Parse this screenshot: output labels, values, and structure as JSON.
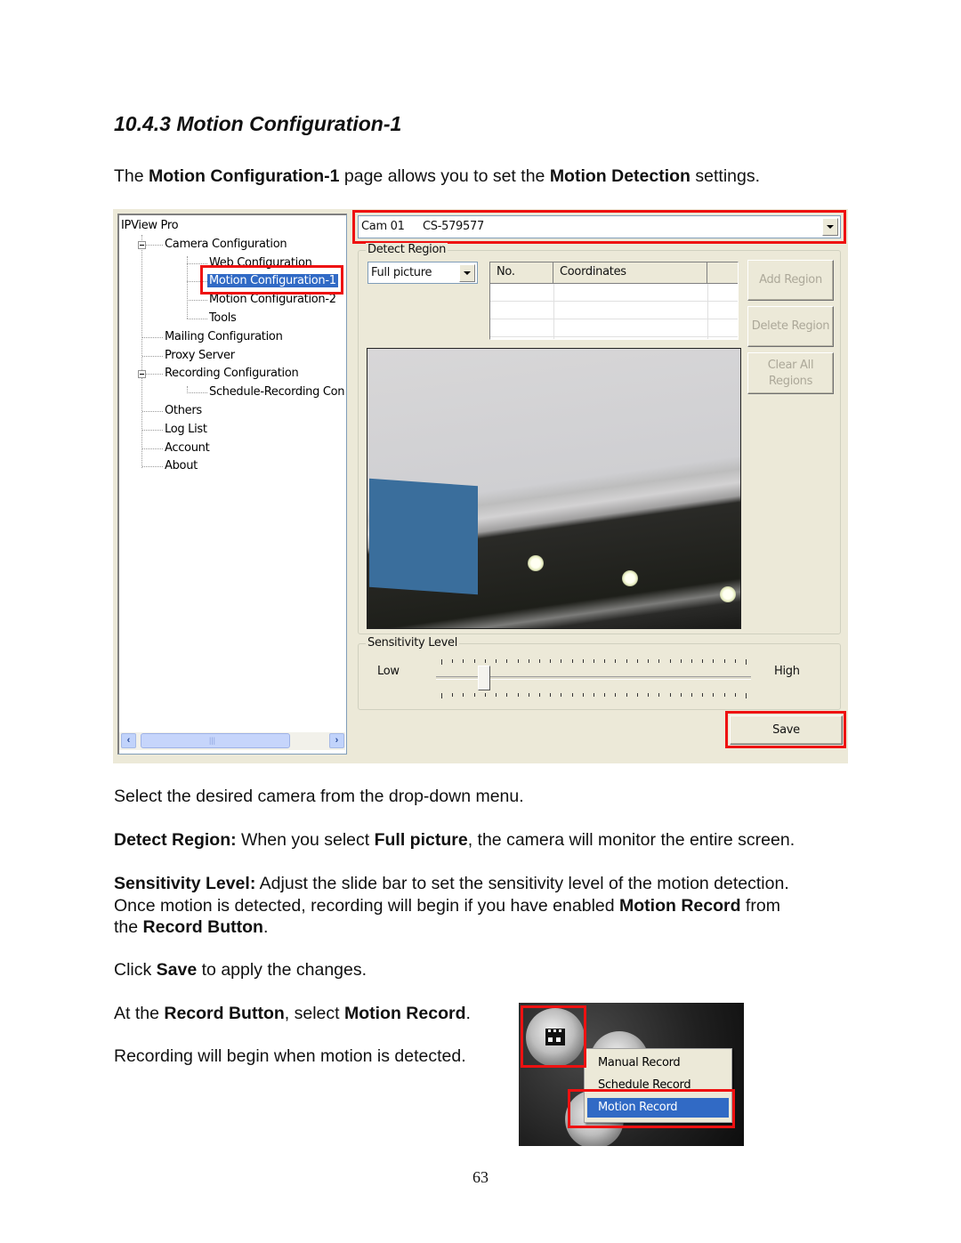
{
  "document": {
    "section_heading": "10.4.3 Motion Configuration-1",
    "intro": {
      "p1": "The ",
      "b1": "Motion Configuration-1",
      "p2": " page allows you to set the ",
      "b2": "Motion Detection",
      "p3": " settings."
    },
    "select_camera": "Select the desired camera from the drop-down menu.",
    "detect_region": {
      "label": "Detect Region:",
      "p1": " When you select ",
      "b1": "Full picture",
      "p2": ", the camera will monitor the entire screen."
    },
    "sensitivity": {
      "label": "Sensitivity Level:",
      "line1": " Adjust the slide bar to set the sensitivity level of the motion detection.",
      "line2_p1": "Once motion is detected, recording will begin if you have enabled ",
      "line2_b1": "Motion Record",
      "line2_p2": " from",
      "line3_p1": "the ",
      "line3_b1": "Record Button",
      "line3_p2": "."
    },
    "save_instruction": {
      "p1": "Click ",
      "b1": "Save",
      "p2": " to apply the changes."
    },
    "record_instruction": {
      "p1": "At the ",
      "b1": "Record Button",
      "p2": ", select ",
      "b2": "Motion Record",
      "p3": "."
    },
    "recording_note": "Recording will begin when motion is detected.",
    "page_number": "63"
  },
  "app": {
    "tree": {
      "root": "IPView Pro",
      "items": [
        {
          "label": "Camera Configuration",
          "level": 1,
          "expanded": true
        },
        {
          "label": "Web Configuration",
          "level": 2
        },
        {
          "label": "Motion Configuration-1",
          "level": 2,
          "selected": true
        },
        {
          "label": "Motion Configuration-2",
          "level": 2
        },
        {
          "label": "Tools",
          "level": 2
        },
        {
          "label": "Mailing Configuration",
          "level": 1
        },
        {
          "label": "Proxy Server",
          "level": 1
        },
        {
          "label": "Recording Configuration",
          "level": 1,
          "expanded": true
        },
        {
          "label": "Schedule-Recording Con",
          "level": 2
        },
        {
          "label": "Others",
          "level": 1
        },
        {
          "label": "Log List",
          "level": 1
        },
        {
          "label": "Account",
          "level": 1
        },
        {
          "label": "About",
          "level": 1
        }
      ]
    },
    "camera_select": {
      "camera_id": "Cam 01",
      "camera_name": "CS-579577"
    },
    "detect_region": {
      "group_label": "Detect Region",
      "mode_value": "Full picture",
      "table_headers": [
        "No.",
        "Coordinates",
        ""
      ],
      "table_rows": [
        [
          "",
          "",
          ""
        ],
        [
          "",
          "",
          ""
        ],
        [
          "",
          "",
          ""
        ]
      ],
      "buttons": {
        "add": "Add Region",
        "delete": "Delete Region",
        "clear_line1": "Clear All",
        "clear_line2": "Regions"
      }
    },
    "sensitivity": {
      "group_label": "Sensitivity Level",
      "low_label": "Low",
      "high_label": "High",
      "value_fraction": 0.14,
      "tick_count": 29
    },
    "save_label": "Save",
    "highlight_color": "#ee1111",
    "selection_color": "#316ac5"
  },
  "record_menu": {
    "items": [
      {
        "label": "Manual Record"
      },
      {
        "label": "Schedule Record"
      },
      {
        "label": "Motion Record",
        "active": true
      }
    ]
  }
}
